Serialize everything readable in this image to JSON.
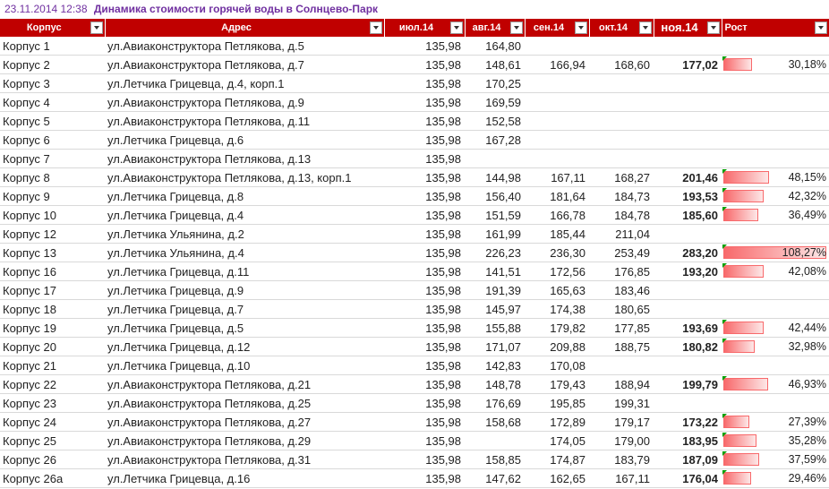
{
  "title": {
    "timestamp": "23.11.2014 12:38",
    "text": "Динамика стоимости горячей воды в Солнцево-Парк"
  },
  "columns": {
    "korpus": "Корпус",
    "address": "Адрес",
    "jul": "июл.14",
    "aug": "авг.14",
    "sep": "сен.14",
    "oct": "окт.14",
    "nov": "ноя.14",
    "growth": "Рост"
  },
  "colors": {
    "header_bg": "#c00000",
    "title_color": "#7030a0",
    "bar_color": "#f8696b",
    "flag_color": "#00a000"
  },
  "icons": {
    "filter": "dropdown-filter-icon"
  },
  "rows": [
    {
      "korpus": "Корпус 1",
      "address": "ул.Авиаконструктора Петлякова, д.5",
      "jul": "135,98",
      "aug": "164,80",
      "sep": "",
      "oct": "",
      "nov": "",
      "growth": "",
      "growth_value": 0
    },
    {
      "korpus": "Корпус 2",
      "address": "ул.Авиаконструктора Петлякова, д.7",
      "jul": "135,98",
      "aug": "148,61",
      "sep": "166,94",
      "oct": "168,60",
      "nov": "177,02",
      "growth": "30,18%",
      "growth_value": 30.18
    },
    {
      "korpus": "Корпус 3",
      "address": "ул.Летчика Грицевца, д.4, корп.1",
      "jul": "135,98",
      "aug": "170,25",
      "sep": "",
      "oct": "",
      "nov": "",
      "growth": "",
      "growth_value": 0
    },
    {
      "korpus": "Корпус 4",
      "address": "ул.Авиаконструктора Петлякова, д.9",
      "jul": "135,98",
      "aug": "169,59",
      "sep": "",
      "oct": "",
      "nov": "",
      "growth": "",
      "growth_value": 0
    },
    {
      "korpus": "Корпус 5",
      "address": "ул.Авиаконструктора Петлякова, д.11",
      "jul": "135,98",
      "aug": "152,58",
      "sep": "",
      "oct": "",
      "nov": "",
      "growth": "",
      "growth_value": 0
    },
    {
      "korpus": "Корпус 6",
      "address": "ул.Летчика Грицевца, д.6",
      "jul": "135,98",
      "aug": "167,28",
      "sep": "",
      "oct": "",
      "nov": "",
      "growth": "",
      "growth_value": 0
    },
    {
      "korpus": "Корпус 7",
      "address": "ул.Авиаконструктора Петлякова, д.13",
      "jul": "135,98",
      "aug": "",
      "sep": "",
      "oct": "",
      "nov": "",
      "growth": "",
      "growth_value": 0
    },
    {
      "korpus": "Корпус 8",
      "address": "ул.Авиаконструктора Петлякова, д.13, корп.1",
      "jul": "135,98",
      "aug": "144,98",
      "sep": "167,11",
      "oct": "168,27",
      "nov": "201,46",
      "growth": "48,15%",
      "growth_value": 48.15
    },
    {
      "korpus": "Корпус 9",
      "address": "ул.Летчика Грицевца, д.8",
      "jul": "135,98",
      "aug": "156,40",
      "sep": "181,64",
      "oct": "184,73",
      "nov": "193,53",
      "growth": "42,32%",
      "growth_value": 42.32
    },
    {
      "korpus": "Корпус 10",
      "address": "ул.Летчика Грицевца, д.4",
      "jul": "135,98",
      "aug": "151,59",
      "sep": "166,78",
      "oct": "184,78",
      "nov": "185,60",
      "growth": "36,49%",
      "growth_value": 36.49
    },
    {
      "korpus": "Корпус 12",
      "address": "ул.Летчика Ульянина, д.2",
      "jul": "135,98",
      "aug": "161,99",
      "sep": "185,44",
      "oct": "211,04",
      "nov": "",
      "growth": "",
      "growth_value": 0
    },
    {
      "korpus": "Корпус 13",
      "address": "ул.Летчика Ульянина, д.4",
      "jul": "135,98",
      "aug": "226,23",
      "sep": "236,30",
      "oct": "253,49",
      "nov": "283,20",
      "growth": "108,27%",
      "growth_value": 108.27
    },
    {
      "korpus": "Корпус 16",
      "address": "ул.Летчика Грицевца, д.11",
      "jul": "135,98",
      "aug": "141,51",
      "sep": "172,56",
      "oct": "176,85",
      "nov": "193,20",
      "growth": "42,08%",
      "growth_value": 42.08
    },
    {
      "korpus": "Корпус 17",
      "address": "ул.Летчика Грицевца, д.9",
      "jul": "135,98",
      "aug": "191,39",
      "sep": "165,63",
      "oct": "183,46",
      "nov": "",
      "growth": "",
      "growth_value": 0
    },
    {
      "korpus": "Корпус 18",
      "address": "ул.Летчика Грицевца, д.7",
      "jul": "135,98",
      "aug": "145,97",
      "sep": "174,38",
      "oct": "180,65",
      "nov": "",
      "growth": "",
      "growth_value": 0
    },
    {
      "korpus": "Корпус 19",
      "address": "ул.Летчика Грицевца, д.5",
      "jul": "135,98",
      "aug": "155,88",
      "sep": "179,82",
      "oct": "177,85",
      "nov": "193,69",
      "growth": "42,44%",
      "growth_value": 42.44
    },
    {
      "korpus": "Корпус 20",
      "address": "ул.Летчика Грицевца, д.12",
      "jul": "135,98",
      "aug": "171,07",
      "sep": "209,88",
      "oct": "188,75",
      "nov": "180,82",
      "growth": "32,98%",
      "growth_value": 32.98
    },
    {
      "korpus": "Корпус 21",
      "address": "ул.Летчика Грицевца, д.10",
      "jul": "135,98",
      "aug": "142,83",
      "sep": "170,08",
      "oct": "",
      "nov": "",
      "growth": "",
      "growth_value": 0
    },
    {
      "korpus": "Корпус 22",
      "address": "ул.Авиаконструктора Петлякова, д.21",
      "jul": "135,98",
      "aug": "148,78",
      "sep": "179,43",
      "oct": "188,94",
      "nov": "199,79",
      "growth": "46,93%",
      "growth_value": 46.93
    },
    {
      "korpus": "Корпус 23",
      "address": "ул.Авиаконструктора Петлякова, д.25",
      "jul": "135,98",
      "aug": "176,69",
      "sep": "195,85",
      "oct": "199,31",
      "nov": "",
      "growth": "",
      "growth_value": 0
    },
    {
      "korpus": "Корпус 24",
      "address": "ул.Авиаконструктора Петлякова, д.27",
      "jul": "135,98",
      "aug": "158,68",
      "sep": "172,89",
      "oct": "179,17",
      "nov": "173,22",
      "growth": "27,39%",
      "growth_value": 27.39
    },
    {
      "korpus": "Корпус 25",
      "address": "ул.Авиаконструктора Петлякова, д.29",
      "jul": "135,98",
      "aug": "",
      "sep": "174,05",
      "oct": "179,00",
      "nov": "183,95",
      "growth": "35,28%",
      "growth_value": 35.28
    },
    {
      "korpus": "Корпус 26",
      "address": "ул.Авиаконструктора Петлякова, д.31",
      "jul": "135,98",
      "aug": "158,85",
      "sep": "174,87",
      "oct": "183,79",
      "nov": "187,09",
      "growth": "37,59%",
      "growth_value": 37.59
    },
    {
      "korpus": "Корпус 26а",
      "address": "ул.Летчика Грицевца, д.16",
      "jul": "135,98",
      "aug": "147,62",
      "sep": "162,65",
      "oct": "167,11",
      "nov": "176,04",
      "growth": "29,46%",
      "growth_value": 29.46
    }
  ]
}
